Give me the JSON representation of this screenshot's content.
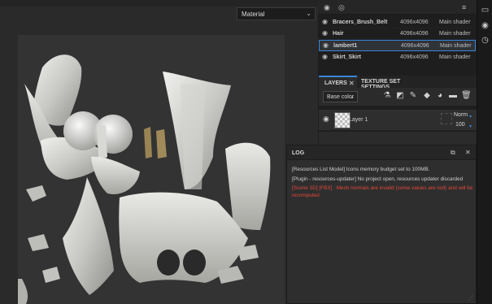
{
  "viewport": {
    "mode_select": "Material"
  },
  "texture_sets": [
    {
      "name": "Bracers_Brush_Belt",
      "resolution": "4096x4096",
      "shader": "Main shader",
      "selected": false
    },
    {
      "name": "Hair",
      "resolution": "4096x4096",
      "shader": "Main shader",
      "selected": false
    },
    {
      "name": "lambert1",
      "resolution": "4096x4096",
      "shader": "Main shader",
      "selected": true
    },
    {
      "name": "Skirt_Skirt",
      "resolution": "4096x4096",
      "shader": "Main shader",
      "selected": false
    }
  ],
  "tabs": {
    "layers": "LAYERS",
    "texture_set_settings": "TEXTURE SET SETTINGS"
  },
  "layers_toolbar": {
    "blend_select": "Base color"
  },
  "layers": [
    {
      "name": "Layer 1",
      "blend": "Norm",
      "opacity": "100"
    }
  ],
  "log": {
    "title": "LOG",
    "lines": [
      {
        "text": "[Resources List Model] Icons memory budget set to 100MB.",
        "level": "info"
      },
      {
        "text": "[Plugin - resources-updater] No project open, resources updater discarded",
        "level": "info"
      },
      {
        "text": "[Scene 3D] [FBX] : Mesh normals are invalid (some values are null) and will be recomputed",
        "level": "error"
      }
    ]
  },
  "colors": {
    "accent": "#3a86d6",
    "error": "#e2483b",
    "panel": "#2b2b2b",
    "uv_background": "#333333"
  },
  "icons": {
    "sidebar": [
      "texture-set-list-icon",
      "properties-icon",
      "history-icon"
    ],
    "layer_tools": [
      "add-effect-icon",
      "add-mask-icon",
      "paint-layer-icon",
      "fill-layer-icon",
      "smart-material-icon",
      "folder-icon",
      "delete-icon"
    ]
  }
}
